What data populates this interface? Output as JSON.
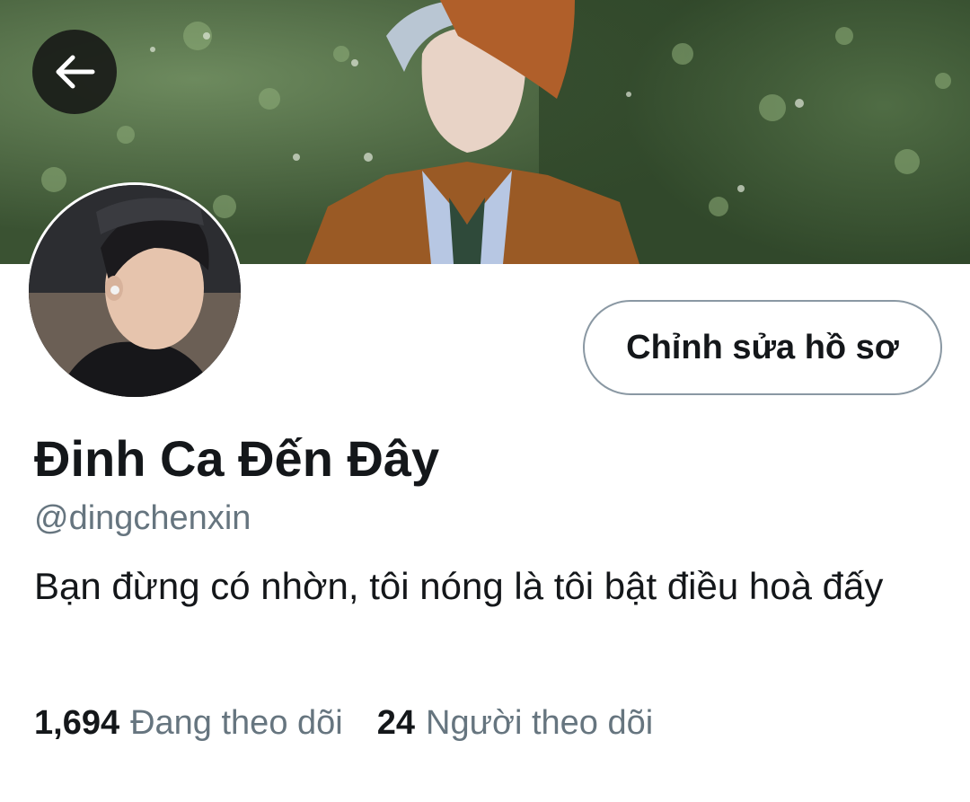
{
  "header": {
    "back_icon": "arrow-left-icon",
    "banner_image": "cover-photo"
  },
  "profile": {
    "avatar_image": "profile-avatar",
    "edit_button_label": "Chỉnh sửa hồ sơ",
    "display_name": "Đinh Ca Đến Đây",
    "handle": "@dingchenxin",
    "bio": "Bạn đừng có nhờn, tôi nóng là tôi bật điều hoà đấy"
  },
  "stats": {
    "following_count": "1,694",
    "following_label": "Đang theo dõi",
    "followers_count": "24",
    "followers_label": "Người theo dõi"
  },
  "colors": {
    "text_primary": "#14171a",
    "text_secondary": "#66757f",
    "border": "#8a98a3",
    "back_button_bg": "#191b18"
  }
}
